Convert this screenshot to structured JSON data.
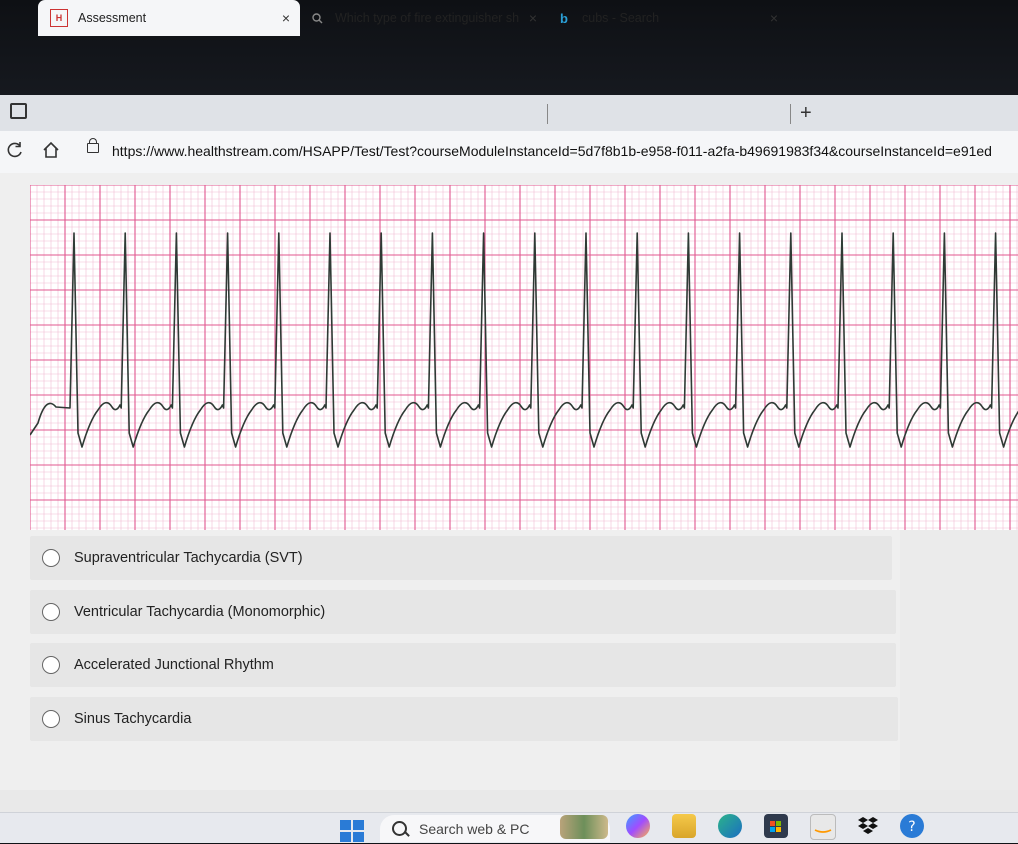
{
  "browser": {
    "tabs": [
      {
        "favicon": "H",
        "title": "Assessment",
        "active": true
      },
      {
        "favicon": "search-icon",
        "title": "Which type of fire extinguisher sh",
        "active": false
      },
      {
        "favicon": "b",
        "title": "cubs - Search",
        "active": false
      }
    ],
    "close_glyph": "×",
    "new_tab_glyph": "+",
    "url": "https://www.healthstream.com/HSAPP/Test/Test?courseModuleInstanceId=5d7f8b1b-e958-f011-a2fa-b49691983f34&courseInstanceId=e91ed"
  },
  "question": {
    "options": [
      {
        "label": "Supraventricular Tachycardia (SVT)"
      },
      {
        "label": "Ventricular Tachycardia (Monomorphic)"
      },
      {
        "label": "Accelerated Junctional Rhythm"
      },
      {
        "label": "Sinus Tachycardia"
      }
    ]
  },
  "taskbar": {
    "search_placeholder": "Search web & PC",
    "icons": [
      "windows-icon",
      "search-icon",
      "widgets-icon",
      "copilot-icon",
      "file-explorer-icon",
      "edge-icon",
      "store-icon",
      "amazon-icon",
      "dropbox-icon",
      "help-icon"
    ]
  },
  "colors": {
    "grid_major": "#e0578f",
    "grid_minor": "#f2bcd2",
    "trace": "#2f3a35"
  }
}
